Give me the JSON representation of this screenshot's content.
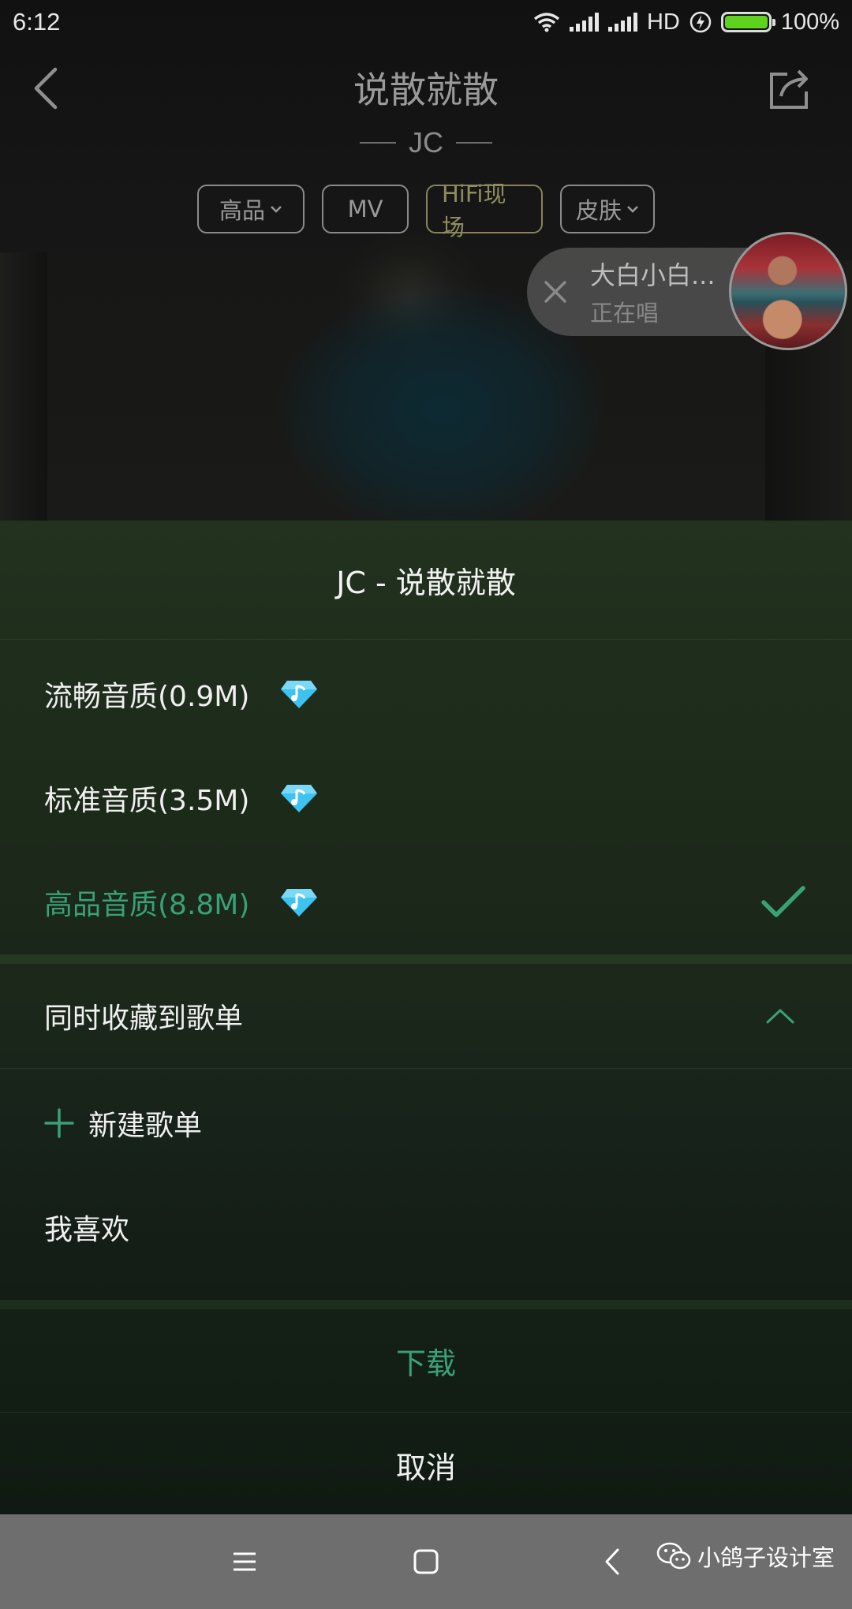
{
  "status_bar": {
    "time": "6:12",
    "network": "HD",
    "battery_pct": "100%",
    "battery_level": 1.0,
    "battery_color": "#5fd11f"
  },
  "player": {
    "title": "说散就散",
    "artist": "JC",
    "pills": [
      {
        "label": "高品",
        "has_dropdown": true
      },
      {
        "label": "MV",
        "has_dropdown": false
      },
      {
        "label": "HiFi现场",
        "has_dropdown": false
      },
      {
        "label": "皮肤",
        "has_dropdown": true
      }
    ],
    "singing_bubble": {
      "name": "大白小白...",
      "state": "正在唱"
    }
  },
  "download_sheet": {
    "title": "JC - 说散就散",
    "quality_options": [
      {
        "label": "流畅音质(0.9M)",
        "icon": "vip-diamond-icon",
        "selected": false
      },
      {
        "label": "标准音质(3.5M)",
        "icon": "vip-diamond-icon",
        "selected": false
      },
      {
        "label": "高品音质(8.8M)",
        "icon": "vip-diamond-icon",
        "selected": true
      }
    ],
    "playlist_section": {
      "header": "同时收藏到歌单",
      "new_playlist_label": "新建歌单",
      "playlists": [
        "我喜欢"
      ]
    },
    "download_label": "下载",
    "cancel_label": "取消"
  },
  "nav_bar": {
    "buttons": [
      "menu-icon",
      "home-icon",
      "back-icon"
    ]
  },
  "watermark": {
    "text": "小鸽子设计室"
  },
  "colors": {
    "accent_green": "#3aa177",
    "diamond_blue": "#3cc3f0",
    "hifi_gold": "#8f8d5d"
  }
}
